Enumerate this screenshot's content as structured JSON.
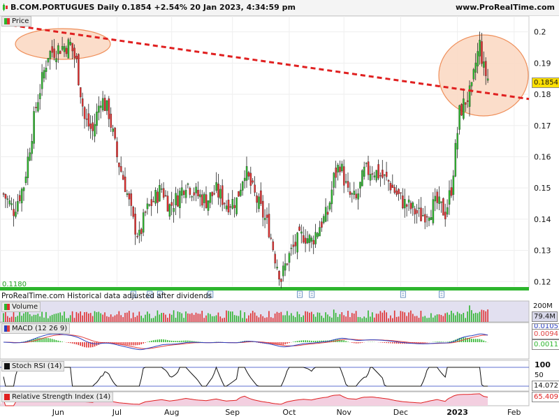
{
  "header": {
    "title": "B.COM.PORTUGUES Daily 0.1854 +2.54% 20 Jan 2023, 4:34:59 pm",
    "site": "www.ProRealTime.com"
  },
  "panels": {
    "price_label": "Price",
    "volume_label": "Volume",
    "macd_label": "MACD (12 26 9)",
    "stochrsi_label": "Stoch RSI (14)",
    "rsi_label": "Relative Strength Index (14)"
  },
  "footer_note": "ProRealTime.com Historical data adjusted after dividends",
  "price_low_label": "0.1180",
  "value_tags": {
    "price": "0.1854",
    "volume_max": "200M",
    "volume": "79.4M",
    "macd_a": "0.0105",
    "macd_b": "0.0094",
    "macd_c": "0.0011",
    "stoch_top": "100",
    "stoch_mid": "50",
    "stoch_val": "14.072",
    "rsi_val": "65.409"
  },
  "colors": {
    "up": "#2db52d",
    "down": "#e03030",
    "trendline": "#e02020",
    "ellipse_fill": "#fbd9c4",
    "ellipse_stroke": "#ef8f5a",
    "macd_line": "#2a3fbf",
    "signal_line": "#e04040"
  },
  "chart_data": {
    "type": "candlestick",
    "x_tick_labels": [
      "Jun",
      "Jul",
      "Aug",
      "Sep",
      "Oct",
      "Nov",
      "Dec",
      "2023",
      "Feb"
    ],
    "y_tick_labels": [
      "0.2",
      "0.19",
      "0.18",
      "0.17",
      "0.16",
      "0.15",
      "0.14",
      "0.13",
      "0.12"
    ],
    "ylim": [
      0.1185,
      0.2035
    ],
    "anchors": [
      {
        "day": 0,
        "close": 0.148
      },
      {
        "day": 5,
        "close": 0.143
      },
      {
        "day": 10,
        "close": 0.151
      },
      {
        "day": 16,
        "close": 0.176
      },
      {
        "day": 22,
        "close": 0.193
      },
      {
        "day": 28,
        "close": 0.195
      },
      {
        "day": 33,
        "close": 0.196
      },
      {
        "day": 36,
        "close": 0.19
      },
      {
        "day": 40,
        "close": 0.172
      },
      {
        "day": 44,
        "close": 0.168
      },
      {
        "day": 48,
        "close": 0.179
      },
      {
        "day": 52,
        "close": 0.174
      },
      {
        "day": 56,
        "close": 0.16
      },
      {
        "day": 60,
        "close": 0.151
      },
      {
        "day": 64,
        "close": 0.139
      },
      {
        "day": 67,
        "close": 0.134
      },
      {
        "day": 70,
        "close": 0.142
      },
      {
        "day": 74,
        "close": 0.146
      },
      {
        "day": 78,
        "close": 0.15
      },
      {
        "day": 82,
        "close": 0.144
      },
      {
        "day": 86,
        "close": 0.147
      },
      {
        "day": 90,
        "close": 0.152
      },
      {
        "day": 95,
        "close": 0.148
      },
      {
        "day": 100,
        "close": 0.146
      },
      {
        "day": 105,
        "close": 0.149
      },
      {
        "day": 110,
        "close": 0.145
      },
      {
        "day": 115,
        "close": 0.146
      },
      {
        "day": 119,
        "close": 0.156
      },
      {
        "day": 123,
        "close": 0.149
      },
      {
        "day": 127,
        "close": 0.143
      },
      {
        "day": 131,
        "close": 0.137
      },
      {
        "day": 134,
        "close": 0.128
      },
      {
        "day": 137,
        "close": 0.121
      },
      {
        "day": 140,
        "close": 0.127
      },
      {
        "day": 144,
        "close": 0.132
      },
      {
        "day": 148,
        "close": 0.135
      },
      {
        "day": 152,
        "close": 0.133
      },
      {
        "day": 156,
        "close": 0.138
      },
      {
        "day": 160,
        "close": 0.142
      },
      {
        "day": 163,
        "close": 0.153
      },
      {
        "day": 166,
        "close": 0.158
      },
      {
        "day": 170,
        "close": 0.148
      },
      {
        "day": 174,
        "close": 0.146
      },
      {
        "day": 178,
        "close": 0.155
      },
      {
        "day": 182,
        "close": 0.156
      },
      {
        "day": 186,
        "close": 0.154
      },
      {
        "day": 190,
        "close": 0.152
      },
      {
        "day": 194,
        "close": 0.148
      },
      {
        "day": 198,
        "close": 0.145
      },
      {
        "day": 202,
        "close": 0.143
      },
      {
        "day": 206,
        "close": 0.141
      },
      {
        "day": 210,
        "close": 0.143
      },
      {
        "day": 214,
        "close": 0.145
      },
      {
        "day": 218,
        "close": 0.142
      },
      {
        "day": 221,
        "close": 0.15
      },
      {
        "day": 223,
        "close": 0.162
      },
      {
        "day": 225,
        "close": 0.174
      },
      {
        "day": 228,
        "close": 0.178
      },
      {
        "day": 231,
        "close": 0.181
      },
      {
        "day": 233,
        "close": 0.19
      },
      {
        "day": 235,
        "close": 0.196
      },
      {
        "day": 237,
        "close": 0.188
      },
      {
        "day": 239,
        "close": 0.185
      }
    ],
    "trendline": [
      {
        "day": 0,
        "price": 0.2025
      },
      {
        "day": 246,
        "price": 0.1785
      }
    ],
    "stoch_top": 100,
    "stoch_mid": 50,
    "stoch_last": 14.072,
    "rsi_last": 65.409,
    "macd_last": 0.0105,
    "signal_last": 0.0094,
    "histogram_last": 0.0011,
    "volume_last": "79.4M",
    "volume_axis_max": "200M"
  }
}
